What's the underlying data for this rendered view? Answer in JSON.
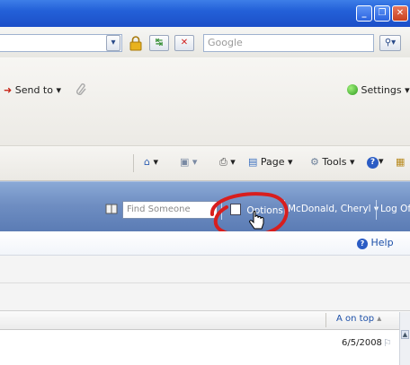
{
  "search": {
    "placeholder": "Google"
  },
  "toolbar": {
    "send_to_label": "Send to",
    "settings_label": "Settings"
  },
  "commandbar": {
    "page_label": "Page",
    "tools_label": "Tools"
  },
  "owa": {
    "find_someone_placeholder": "Find Someone",
    "options_label": "Options",
    "user_name": "McDonald, Cheryl",
    "log_off_label": "Log Of"
  },
  "help": {
    "label": "Help"
  },
  "list": {
    "sort_label": "A on top",
    "rows": [
      {
        "date": "6/5/2008"
      }
    ]
  },
  "colors": {
    "title_bar": "#2360d8",
    "owa_bar": "#6f8ec2",
    "highlight_circle": "#d81e1e"
  }
}
